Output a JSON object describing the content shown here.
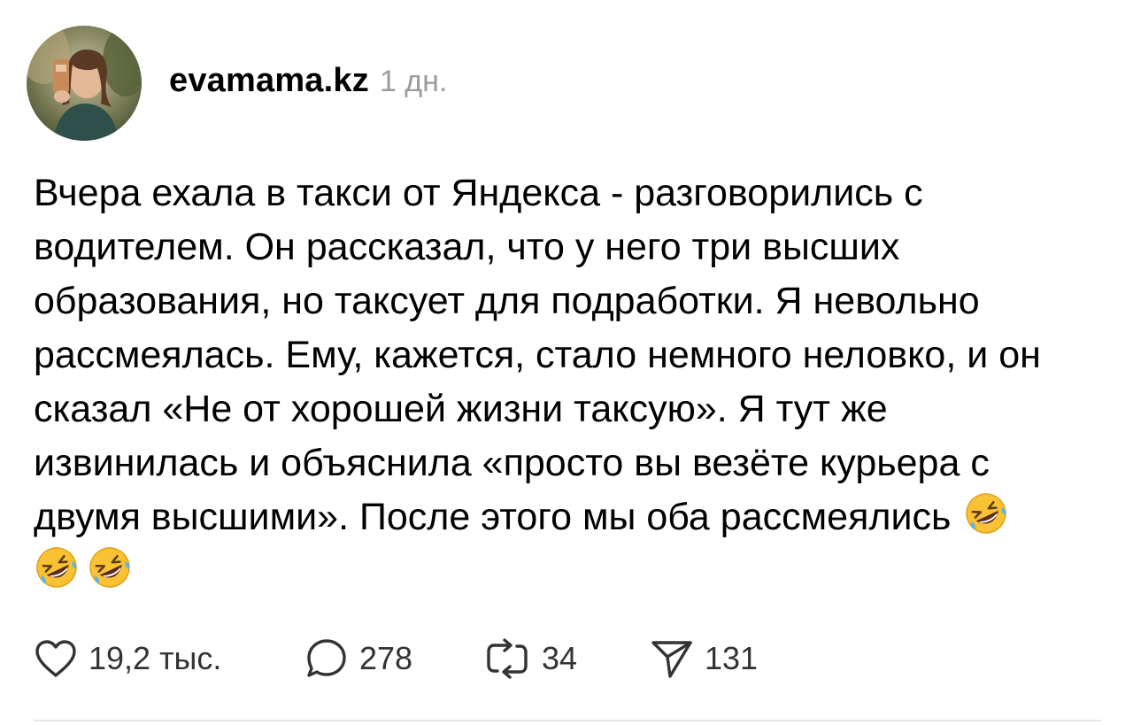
{
  "post": {
    "author": {
      "username": "evamama.kz",
      "time_ago": "1 дн."
    },
    "text": "Вчера ехала в такси от Яндекса - разговорились с водителем. Он рассказал, что у него три высших образования, но таксует для подработки. Я невольно рассмеялась. Ему, кажется, стало немного неловко, и он сказал «Не от хорошей жизни таксую». Я тут же извинилась и объяснила «просто вы везёте курьера с двумя высшими». После этого мы оба рассмеялись",
    "emoji": [
      "rolling-on-floor-laughing",
      "rolling-on-floor-laughing",
      "rolling-on-floor-laughing"
    ],
    "actions": {
      "likes": "19,2 тыс.",
      "comments": "278",
      "reposts": "34",
      "shares": "131"
    }
  },
  "colors": {
    "text": "#000000",
    "muted": "#9b9b9b",
    "icon": "#333333",
    "divider": "#e6e6e6",
    "emoji": "#f9c234"
  }
}
